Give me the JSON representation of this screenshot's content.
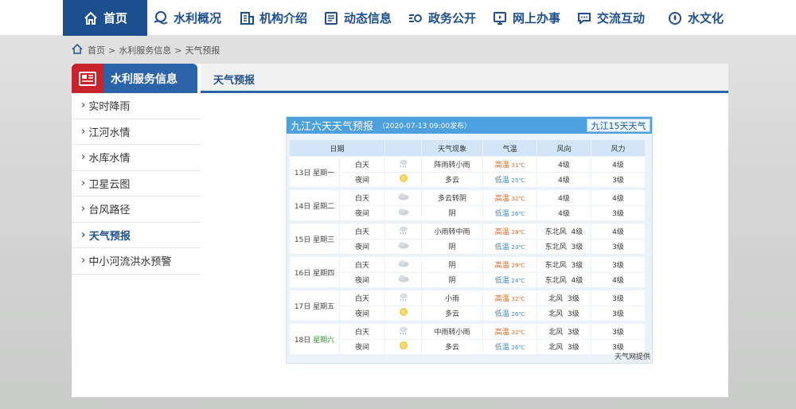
{
  "nav": {
    "home": "首页",
    "items": [
      {
        "label": "水利概况",
        "icon": "water-flow-icon"
      },
      {
        "label": "机构介绍",
        "icon": "building-icon"
      },
      {
        "label": "动态信息",
        "icon": "news-icon"
      },
      {
        "label": "政务公开",
        "icon": "eye-icon"
      },
      {
        "label": "网上办事",
        "icon": "monitor-icon"
      },
      {
        "label": "交流互动",
        "icon": "chat-icon"
      },
      {
        "label": "水文化",
        "icon": "water-drop-icon"
      }
    ]
  },
  "breadcrumb": {
    "home": "首页",
    "sep1": ">",
    "section": "水利服务信息",
    "sep2": ">",
    "page": "天气预报"
  },
  "sidebar": {
    "title": "水利服务信息",
    "items": [
      {
        "label": "实时降雨"
      },
      {
        "label": "江河水情"
      },
      {
        "label": "水库水情"
      },
      {
        "label": "卫星云图"
      },
      {
        "label": "台风路径"
      },
      {
        "label": "天气预报",
        "active": true
      },
      {
        "label": "中小河流洪水预警"
      }
    ]
  },
  "content": {
    "tab": "天气预报"
  },
  "weather": {
    "title": "九江六天天气预报",
    "published": "（2020-07-13 09:00发布）",
    "button": "九江15天天气",
    "footer": "天气网提供",
    "headers": [
      "日期",
      "天气现象",
      "气温",
      "风向",
      "风力"
    ],
    "day_label": "白天",
    "night_label": "夜间",
    "hi_label": "高温",
    "lo_label": "低温",
    "unit": "℃",
    "days": [
      {
        "date": "13日 星期一",
        "day_icon": "rain-icon",
        "day_weather": "阵雨转小雨",
        "night_icon": "sun-icon",
        "night_weather": "多云",
        "hi": "31",
        "lo": "25",
        "wind_day": "",
        "wind_night": "",
        "power_day": "4级",
        "power_night": "4级",
        "wdl_day": "4级",
        "wdl_night": "3级"
      },
      {
        "date": "14日 星期二",
        "day_icon": "cloud-icon",
        "day_weather": "多云转阴",
        "night_icon": "cloud-icon",
        "night_weather": "阴",
        "hi": "32",
        "lo": "26",
        "wind_day": "",
        "wind_night": "",
        "power_day": "4级",
        "power_night": "4级",
        "wdl_day": "4级",
        "wdl_night": "3级"
      },
      {
        "date": "15日 星期三",
        "day_icon": "rain-icon",
        "day_weather": "小雨转中雨",
        "night_icon": "cloud-icon",
        "night_weather": "阴",
        "hi": "28",
        "lo": "23",
        "wind_day": "东北风",
        "wind_night": "东北风",
        "power_day": "4级",
        "power_night": "3级",
        "wdl_day": "4级",
        "wdl_night": "3级"
      },
      {
        "date": "16日 星期四",
        "day_icon": "cloud-icon",
        "day_weather": "阴",
        "night_icon": "cloud-icon",
        "night_weather": "阴",
        "hi": "29",
        "lo": "24",
        "wind_day": "东北风",
        "wind_night": "东北风",
        "power_day": "3级",
        "power_night": "4级",
        "wdl_day": "3级",
        "wdl_night": "4级"
      },
      {
        "date": "17日 星期五",
        "day_icon": "rain-icon",
        "day_weather": "小雨",
        "night_icon": "sun-icon",
        "night_weather": "多云",
        "hi": "32",
        "lo": "26",
        "wind_day": "北风",
        "wind_night": "北风",
        "power_day": "3级",
        "power_night": "3级",
        "wdl_day": "3级",
        "wdl_night": "3级"
      },
      {
        "date": "18日",
        "date2": "星期六",
        "day_icon": "rain-icon",
        "day_weather": "中雨转小雨",
        "night_icon": "sun-icon",
        "night_weather": "多云",
        "hi": "32",
        "lo": "26",
        "wind_day": "北风",
        "wind_night": "北风",
        "power_day": "3级",
        "power_night": "3级",
        "wdl_day": "3级",
        "wdl_night": "3级"
      }
    ]
  },
  "colors": {
    "primary": "#1d4f8f",
    "accent_red": "#c8232b",
    "widget_head": "#4ba0dd",
    "high_temp": "#e0641e",
    "low_temp": "#3a86c6",
    "weekend": "#2a9a2a"
  }
}
